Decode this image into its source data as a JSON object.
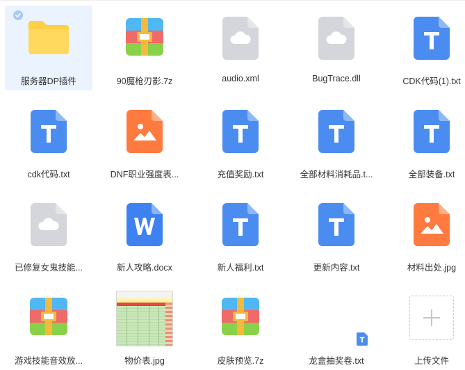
{
  "colors": {
    "selected_bg": "#eaf3fe",
    "text": "#333333",
    "txt_blue": "#4b8cf1",
    "cloud_gray": "#d4d6db",
    "image_orange": "#ff7a3f",
    "word_blue": "#3d82f0",
    "folder_yellow": "#ffc83d"
  },
  "files": [
    {
      "label": "服务器DP插件",
      "icon": "folder-icon",
      "selected": true
    },
    {
      "label": "90魔枪刃影.7z",
      "icon": "archive-icon"
    },
    {
      "label": "audio.xml",
      "icon": "cloud-file-icon"
    },
    {
      "label": "BugTrace.dll",
      "icon": "cloud-file-icon"
    },
    {
      "label": "CDK代码(1).txt",
      "icon": "txt-file-icon"
    },
    {
      "label": "cdk代码.txt",
      "icon": "txt-file-icon"
    },
    {
      "label": "DNF职业强度表...",
      "icon": "image-file-icon"
    },
    {
      "label": "充值奖励.txt",
      "icon": "txt-file-icon"
    },
    {
      "label": "全部材料消耗品.t...",
      "icon": "txt-file-icon"
    },
    {
      "label": "全部装备.txt",
      "icon": "txt-file-icon"
    },
    {
      "label": "已修复女鬼技能...",
      "icon": "cloud-file-icon"
    },
    {
      "label": "新人攻略.docx",
      "icon": "word-file-icon"
    },
    {
      "label": "新人福利.txt",
      "icon": "txt-file-icon"
    },
    {
      "label": "更新内容.txt",
      "icon": "txt-file-icon"
    },
    {
      "label": "材料出处.jpg",
      "icon": "image-file-icon"
    },
    {
      "label": "游戏技能音效放...",
      "icon": "archive-icon"
    },
    {
      "label": "物价表.jpg",
      "icon": "spreadsheet-thumbnail"
    },
    {
      "label": "皮肤预览.7z",
      "icon": "archive-icon"
    },
    {
      "label": "龙盒抽奖卷.txt",
      "icon": "txt-mini-icon"
    },
    {
      "label": "上传文件",
      "icon": "plus-icon"
    }
  ]
}
